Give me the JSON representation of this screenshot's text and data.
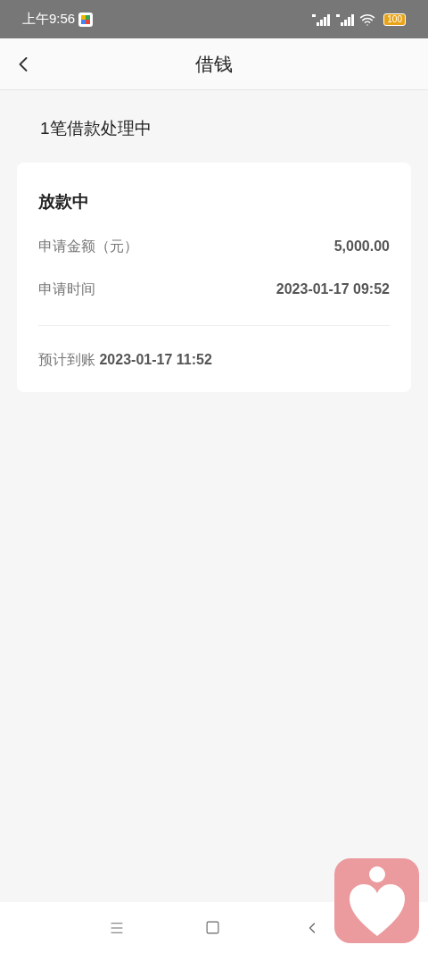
{
  "status_bar": {
    "time": "上午9:56",
    "battery": "100"
  },
  "header": {
    "title": "借钱"
  },
  "summary": "1笔借款处理中",
  "card": {
    "status": "放款中",
    "rows": [
      {
        "label": "申请金额（元）",
        "value": "5,000.00"
      },
      {
        "label": "申请时间",
        "value": "2023-01-17 09:52"
      }
    ],
    "footer_label": "预计到账",
    "footer_value": "2023-01-17 11:52"
  }
}
